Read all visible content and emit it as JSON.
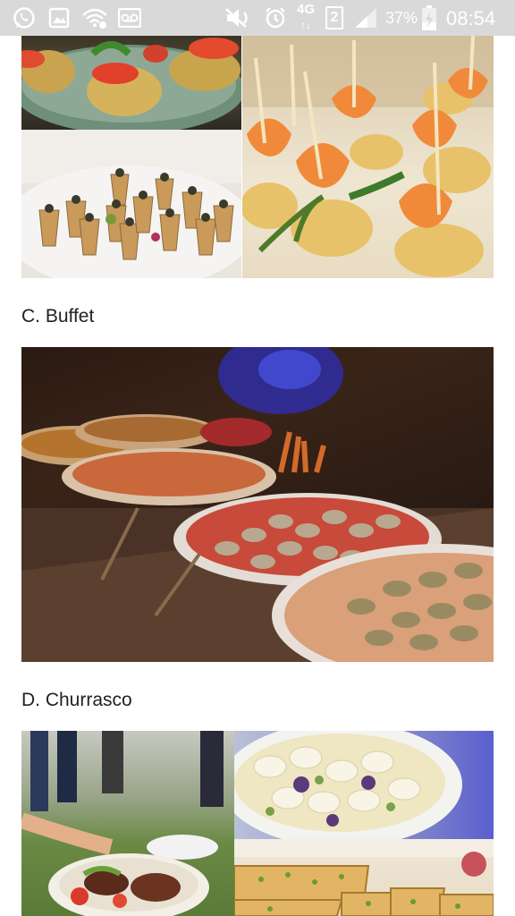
{
  "status_bar": {
    "icons": [
      "whatsapp-icon",
      "image-icon",
      "wifi-icon",
      "voicemail-icon",
      "mute-icon",
      "alarm-icon",
      "4g-icon",
      "sim-icon",
      "signal-icon",
      "battery-charging-icon"
    ],
    "network": "4G",
    "sim": "2",
    "battery": "37%",
    "time": "08:54"
  },
  "sections": [
    {
      "title": "C. Buffet"
    },
    {
      "title": "D. Churrasco"
    }
  ]
}
